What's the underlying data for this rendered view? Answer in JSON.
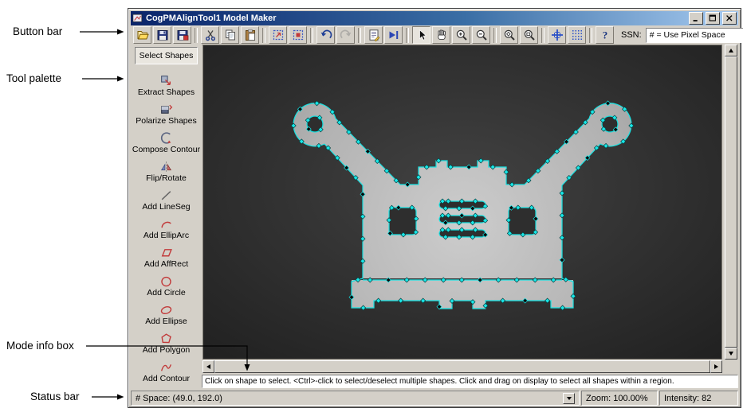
{
  "annotations": {
    "button_bar": "Button bar",
    "tool_palette": "Tool palette",
    "mode_info_box": "Mode info box",
    "status_bar": "Status bar"
  },
  "window": {
    "title": "CogPMAlignTool1 Model Maker",
    "toolbar": {
      "ssn_label": "SSN:",
      "ssn_value": "# = Use Pixel Space",
      "groups": [
        [
          {
            "icon": "open-folder-icon"
          },
          {
            "icon": "save-icon"
          },
          {
            "icon": "save-image-icon"
          }
        ],
        [
          {
            "icon": "cut-icon"
          },
          {
            "icon": "copy-icon"
          },
          {
            "icon": "paste-icon"
          }
        ],
        [
          {
            "icon": "train-shape-icon"
          },
          {
            "icon": "train-region-icon"
          }
        ],
        [
          {
            "icon": "undo-icon"
          },
          {
            "icon": "redo-icon",
            "disabled": true
          }
        ],
        [
          {
            "icon": "properties-icon"
          },
          {
            "icon": "run-marker-icon"
          }
        ],
        [
          {
            "icon": "select-cursor-icon",
            "pressed": true
          },
          {
            "icon": "pan-hand-icon"
          },
          {
            "icon": "zoom-in-icon"
          },
          {
            "icon": "zoom-out-icon"
          }
        ],
        [
          {
            "icon": "zoom-expand-icon"
          },
          {
            "icon": "zoom-fit-icon"
          }
        ],
        [
          {
            "icon": "axes-grid-icon"
          },
          {
            "icon": "pixel-grid-icon"
          }
        ],
        [
          {
            "icon": "help-icon"
          }
        ]
      ]
    },
    "palette": {
      "items": [
        {
          "label": "Select Shapes",
          "selected": true
        },
        {
          "label": "Extract Shapes",
          "icon": "extract-shapes-icon"
        },
        {
          "label": "Polarize Shapes",
          "icon": "polarize-shapes-icon"
        },
        {
          "label": "Compose Contour",
          "icon": "compose-contour-icon"
        },
        {
          "label": "Flip/Rotate",
          "icon": "flip-rotate-icon"
        },
        {
          "label": "Add LineSeg",
          "icon": "add-lineseg-icon"
        },
        {
          "label": "Add EllipArc",
          "icon": "add-elliparc-icon"
        },
        {
          "label": "Add AffRect",
          "icon": "add-affrect-icon"
        },
        {
          "label": "Add Circle",
          "icon": "add-circle-icon"
        },
        {
          "label": "Add Ellipse",
          "icon": "add-ellipse-icon"
        },
        {
          "label": "Add Polygon",
          "icon": "add-polygon-icon"
        },
        {
          "label": "Add Contour",
          "icon": "add-contour-icon"
        }
      ]
    },
    "mode_info": "Click on shape to select. <Ctrl>-click to select/deselect multiple shapes. Click and drag on display to select all shapes within a region.",
    "status": {
      "space": "# Space:  (49.0, 192.0)",
      "zoom": "Zoom:  100.00%",
      "intensity": "Intensity: 82"
    }
  }
}
